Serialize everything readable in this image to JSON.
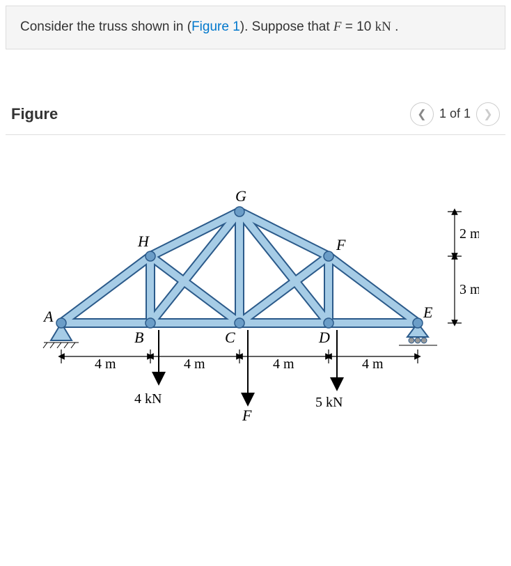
{
  "problem": {
    "prefix": "Consider the truss shown in (",
    "link": "Figure 1",
    "mid": "). Suppose that ",
    "var": "F",
    "eq": " = 10 ",
    "unit": "kN",
    "suffix": " ."
  },
  "figure": {
    "title": "Figure",
    "page": "1 of 1"
  },
  "labels": {
    "A": "A",
    "B": "B",
    "C": "C",
    "D": "D",
    "E": "E",
    "F": "F",
    "G": "G",
    "H": "H"
  },
  "dims": {
    "span1": "4 m",
    "span2": "4 m",
    "span3": "4 m",
    "span4": "4 m",
    "h1": "2 m",
    "h2": "3 m"
  },
  "loads": {
    "atB": "4 kN",
    "atCvar": "F",
    "atD": "5 kN"
  },
  "chart_data": {
    "type": "diagram",
    "description": "Planar truss with 5 bottom nodes (A,B,C,D,E) and 3 top nodes (H,G,F) with applied vertical loads",
    "nodes": {
      "A": {
        "x": 0,
        "y": 0
      },
      "B": {
        "x": 4,
        "y": 0
      },
      "C": {
        "x": 8,
        "y": 0
      },
      "D": {
        "x": 12,
        "y": 0
      },
      "E": {
        "x": 16,
        "y": 0
      },
      "H": {
        "x": 4,
        "y": 3
      },
      "G": {
        "x": 8,
        "y": 5
      },
      "F": {
        "x": 12,
        "y": 3
      }
    },
    "members": [
      "AB",
      "BC",
      "CD",
      "DE",
      "AH",
      "HG",
      "GF",
      "FE",
      "HB",
      "GC",
      "FD",
      "HC",
      "GB",
      "GD",
      "FC"
    ],
    "supports": {
      "A": "pin",
      "E": "roller"
    },
    "loads_kN": {
      "B": 4,
      "C": "F=10",
      "D": 5
    },
    "vertical_dims_m": {
      "FE_height": 3,
      "G_above_F": 2
    },
    "horizontal_dims_m": [
      4,
      4,
      4,
      4
    ]
  }
}
